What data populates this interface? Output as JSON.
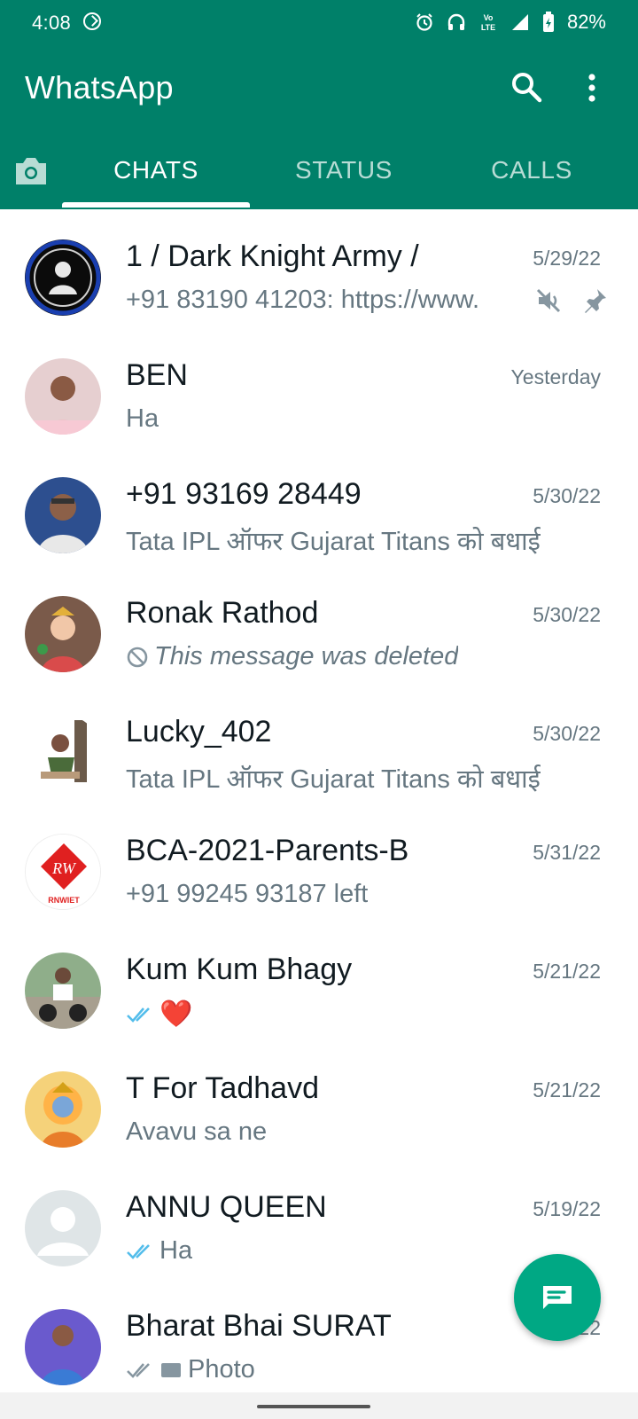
{
  "status_bar": {
    "time": "4:08",
    "battery": "82%",
    "icons": [
      "app-notification-icon",
      "alarm-icon",
      "headphones-icon",
      "volte-icon",
      "signal-icon",
      "battery-icon"
    ]
  },
  "app": {
    "title": "WhatsApp",
    "brand_color": "#008069",
    "accent_color": "#00a884"
  },
  "tabs": [
    {
      "label": "CHATS",
      "selected": true
    },
    {
      "label": "STATUS",
      "selected": false
    },
    {
      "label": "CALLS",
      "selected": false
    }
  ],
  "chats": [
    {
      "name": "1 / Dark Knight Army /",
      "time": "5/29/22",
      "preview": "+91 83190 41203: https://www.",
      "muted": true,
      "pinned": true
    },
    {
      "name": "BEN",
      "time": "Yesterday",
      "preview": "Ha"
    },
    {
      "name": "+91 93169 28449",
      "time": "5/30/22",
      "preview": "Tata IPL ऑफर Gujarat Titans को बधाई"
    },
    {
      "name": "Ronak Rathod",
      "time": "5/30/22",
      "preview": "This message was deleted",
      "deleted": true
    },
    {
      "name": "Lucky_402",
      "time": "5/30/22",
      "preview": "Tata IPL ऑफर Gujarat Titans को बधाई"
    },
    {
      "name": "BCA-2021-Parents-B",
      "time": "5/31/22",
      "preview": "+91 99245 93187 left",
      "avatar_text": "RNWIET"
    },
    {
      "name": "Kum Kum Bhagy",
      "time": "5/21/22",
      "preview": "❤️",
      "read_ticks": true
    },
    {
      "name": "T For Tadhavd",
      "time": "5/21/22",
      "preview": "Avavu sa ne"
    },
    {
      "name": "ANNU QUEEN",
      "time": "5/19/22",
      "preview": "Ha",
      "read_ticks": true
    },
    {
      "name": "Bharat Bhai SURAT",
      "time": "5/?/22",
      "preview": "Photo"
    }
  ]
}
